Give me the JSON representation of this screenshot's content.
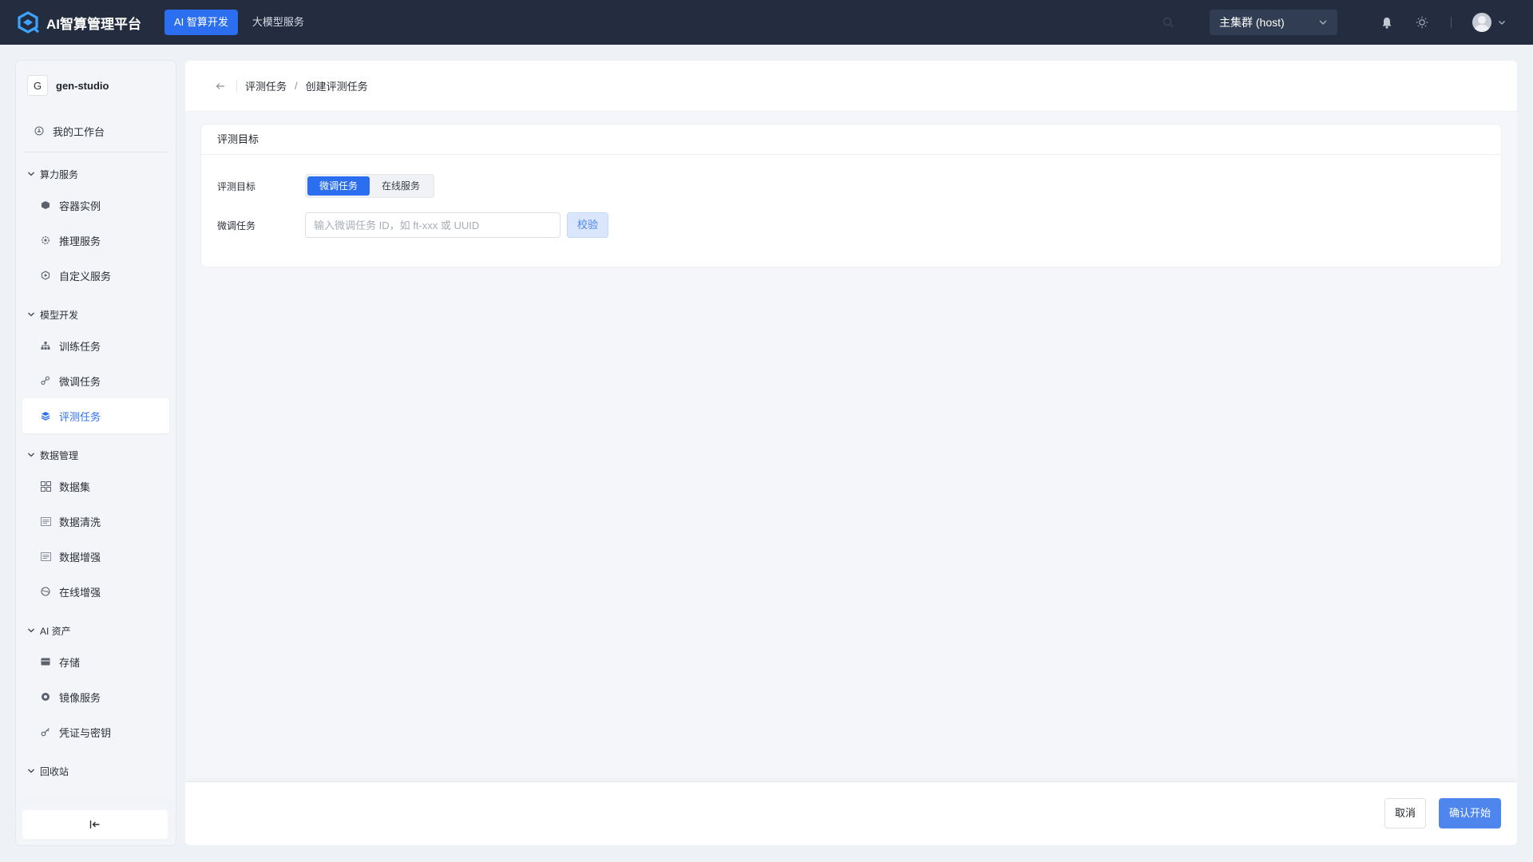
{
  "app": {
    "title": "AI智算管理平台"
  },
  "nav": {
    "tabs": [
      {
        "label": "AI 智算开发",
        "active": true
      },
      {
        "label": "大模型服务",
        "active": false
      }
    ]
  },
  "topright": {
    "cluster_label": "主集群 (host)"
  },
  "sidebar": {
    "project_badge": "G",
    "project_name": "gen-studio",
    "workbench": "我的工作台",
    "groups": [
      {
        "title": "算力服务",
        "items": [
          "容器实例",
          "推理服务",
          "自定义服务"
        ]
      },
      {
        "title": "模型开发",
        "items": [
          "训练任务",
          "微调任务",
          "评测任务"
        ]
      },
      {
        "title": "数据管理",
        "items": [
          "数据集",
          "数据清洗",
          "数据增强",
          "在线增强"
        ]
      },
      {
        "title": "AI 资产",
        "items": [
          "存储",
          "镜像服务",
          "凭证与密钥"
        ]
      },
      {
        "title": "回收站",
        "items": []
      }
    ],
    "active_item": "评测任务",
    "collapse_icon": "collapse-left-icon"
  },
  "breadcrumb": {
    "parent": "评测任务",
    "separator": "/",
    "current": "创建评测任务"
  },
  "card": {
    "title": "评测目标",
    "target_label": "评测目标",
    "segments": [
      {
        "label": "微调任务",
        "active": true
      },
      {
        "label": "在线服务",
        "active": false
      }
    ],
    "task_label": "微调任务",
    "task_input_value": "",
    "task_input_placeholder": "输入微调任务 ID，如 ft-xxx 或 UUID",
    "verify_label": "校验"
  },
  "footer": {
    "cancel_label": "取消",
    "confirm_label": "确认开始"
  },
  "colors": {
    "accent": "#2b6ff0",
    "topbar": "#232d3f",
    "confirm": "#4f86ed"
  }
}
